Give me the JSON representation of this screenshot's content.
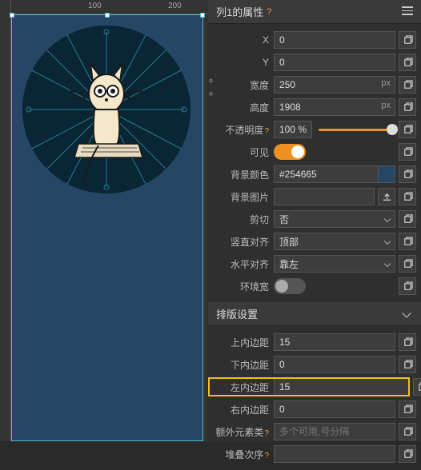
{
  "ruler": {
    "t100": "100",
    "t200": "200"
  },
  "panel": {
    "title": "列1的属性",
    "section2_title": "排版设置",
    "x_label": "X",
    "x_value": "0",
    "y_label": "Y",
    "y_value": "0",
    "width_label": "宽度",
    "width_value": "250",
    "width_unit": "px",
    "height_label": "高度",
    "height_value": "1908",
    "height_unit": "px",
    "opacity_label": "不透明度",
    "opacity_value": "100 %",
    "visible_label": "可见",
    "bgcolor_label": "背景颜色",
    "bgcolor_value": "#254665",
    "bgimage_label": "背景图片",
    "bgimage_value": "",
    "clip_label": "剪切",
    "clip_value": "否",
    "valign_label": "竖直对齐",
    "valign_value": "顶部",
    "halign_label": "水平对齐",
    "halign_value": "靠左",
    "envwidth_label": "环境宽",
    "pad_top_label": "上内边距",
    "pad_top_value": "15",
    "pad_bottom_label": "下内边距",
    "pad_bottom_value": "0",
    "pad_left_label": "左内边距",
    "pad_left_value": "15",
    "pad_right_label": "右内边距",
    "pad_right_value": "0",
    "extra_label": "额外元素类",
    "extra_placeholder": "多个可用,号分隔",
    "stack_label": "堆叠次序"
  },
  "colors": {
    "swatch": "#254665"
  }
}
